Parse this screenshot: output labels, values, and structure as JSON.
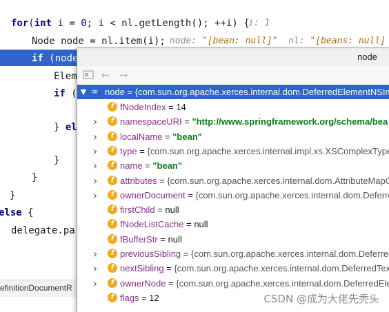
{
  "code": {
    "line1": {
      "kw": "for",
      "a": "(",
      "kw2": "int",
      "b": " i = ",
      "n0": "0",
      "c": "; i < nl.getLength(); ++i) {",
      "hint": "i: 1"
    },
    "line2": {
      "a": "Node node = nl.item(i);",
      "hint_label": "node:",
      "hint_val": "\"[bean: null]\"",
      "hint_label2": "nl:",
      "hint_val2": "\"[beans: null]"
    },
    "line3": {
      "kw": "if",
      "a": " (node"
    },
    "line4": {
      "a": "Elem"
    },
    "line5": {
      "kw": "if",
      "a": " ("
    },
    "line6": {
      "a": "} ",
      "kw": "el"
    },
    "line7": {
      "a": "}"
    },
    "line8": {
      "a": "}"
    },
    "line9": {
      "a": "}"
    },
    "line10": {
      "kw": "else",
      "a": " {"
    },
    "line11": {
      "a": "delegate.par"
    }
  },
  "statusbar": {
    "text": "efinitionDocumentR"
  },
  "popup": {
    "title": "node",
    "toolbar": {
      "back_icon": "back-arrow-icon",
      "forward_icon": "forward-arrow-icon",
      "view_icon": "view-icon"
    },
    "root": {
      "name": "node",
      "value": "= {com.sun.org.apache.xerces.internal.dom.DeferredElementNSIm"
    },
    "fields": [
      {
        "name": "fNodeIndex",
        "eq": " = ",
        "value": "14",
        "type": "num",
        "expandable": false
      },
      {
        "name": "namespaceURI",
        "eq": " = ",
        "value": "\"http://www.springframework.org/schema/bea",
        "type": "url",
        "expandable": true
      },
      {
        "name": "localName",
        "eq": " = ",
        "value": "\"bean\"",
        "type": "str",
        "expandable": true
      },
      {
        "name": "type",
        "eq": " = ",
        "value": "{com.sun.org.apache.xerces.internal.impl.xs.XSComplexTypeD",
        "type": "obj",
        "expandable": true
      },
      {
        "name": "name",
        "eq": " = ",
        "value": "\"bean\"",
        "type": "str",
        "expandable": true
      },
      {
        "name": "attributes",
        "eq": " = ",
        "value": "{com.sun.org.apache.xerces.internal.dom.AttributeMapO",
        "type": "obj",
        "expandable": true
      },
      {
        "name": "ownerDocument",
        "eq": " = ",
        "value": "{com.sun.org.apache.xerces.internal.dom.Deferre",
        "type": "obj",
        "expandable": true
      },
      {
        "name": "firstChild",
        "eq": " = ",
        "value": "null",
        "type": "num",
        "expandable": false
      },
      {
        "name": "fNodeListCache",
        "eq": " = ",
        "value": "null",
        "type": "num",
        "expandable": false
      },
      {
        "name": "fBufferStr",
        "eq": " = ",
        "value": "null",
        "type": "num",
        "expandable": false
      },
      {
        "name": "previousSibling",
        "eq": " = ",
        "value": "{com.sun.org.apache.xerces.internal.dom.Deferred",
        "type": "obj",
        "expandable": true
      },
      {
        "name": "nextSibling",
        "eq": " = ",
        "value": "{com.sun.org.apache.xerces.internal.dom.DeferredTex",
        "type": "obj",
        "expandable": true
      },
      {
        "name": "ownerNode",
        "eq": " = ",
        "value": "{com.sun.org.apache.xerces.internal.dom.DeferredEle",
        "type": "obj",
        "expandable": true
      },
      {
        "name": "flags",
        "eq": " = ",
        "value": "12",
        "type": "num",
        "expandable": false
      }
    ]
  },
  "watermark": "CSDN @成为大佬先秃头",
  "colors": {
    "selection": "#2f65ca",
    "field_icon": "#f4a81b",
    "keyword": "#000080",
    "string": "#067d17"
  }
}
